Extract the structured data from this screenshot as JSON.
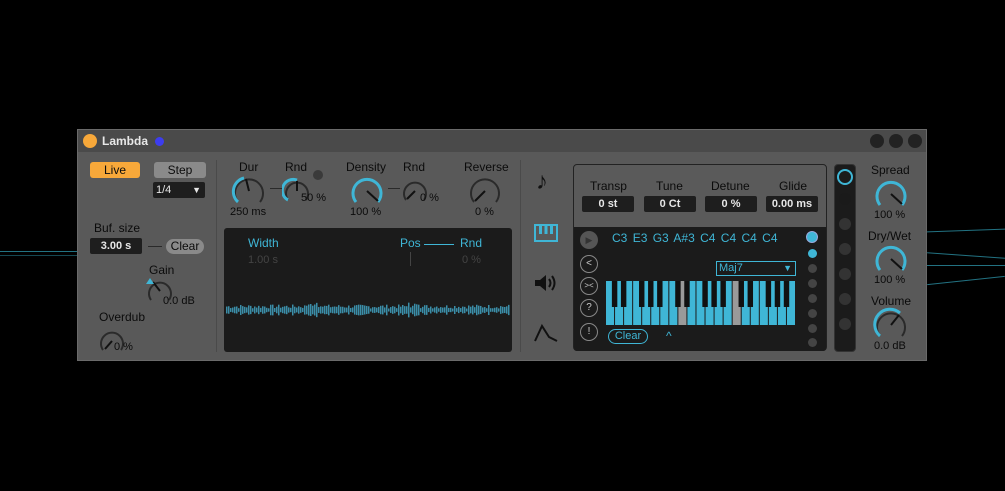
{
  "device": {
    "title": "Lambda",
    "accent": "#3fb6d6",
    "active": "#f7a83a"
  },
  "left": {
    "live_label": "Live",
    "step_label": "Step",
    "step_value": "1/4",
    "bufsize_label": "Buf. size",
    "bufsize_value": "3.00 s",
    "clear_label": "Clear",
    "gain_label": "Gain",
    "gain_value": "0.0 dB",
    "overdub_label": "Overdub",
    "overdub_value": "0 %"
  },
  "grain": {
    "dur_label": "Dur",
    "dur_value": "250 ms",
    "dur_rnd_label": "Rnd",
    "dur_rnd_value": "50 %",
    "density_label": "Density",
    "density_value": "100 %",
    "density_rnd_label": "Rnd",
    "density_rnd_value": "0 %",
    "reverse_label": "Reverse",
    "reverse_value": "0 %"
  },
  "waveform": {
    "width_label": "Width",
    "width_value": "1.00 s",
    "pos_label": "Pos",
    "rnd_label": "Rnd",
    "rnd_value": "0 %"
  },
  "pitch": {
    "transp_label": "Transp",
    "transp_value": "0 st",
    "tune_label": "Tune",
    "tune_value": "0 Ct",
    "detune_label": "Detune",
    "detune_value": "0 %",
    "glide_label": "Glide",
    "glide_value": "0.00 ms",
    "notes": [
      "C3",
      "E3",
      "G3",
      "A#3",
      "C4",
      "C4",
      "C4",
      "C4"
    ],
    "chord": "Maj7",
    "clear_label": "Clear",
    "caret": "^"
  },
  "output": {
    "spread_label": "Spread",
    "spread_value": "100 %",
    "drywet_label": "Dry/Wet",
    "drywet_value": "100 %",
    "volume_label": "Volume",
    "volume_value": "0.0 dB"
  },
  "icons": [
    "note-icon",
    "piano-icon",
    "speaker-icon",
    "envelope-icon"
  ]
}
